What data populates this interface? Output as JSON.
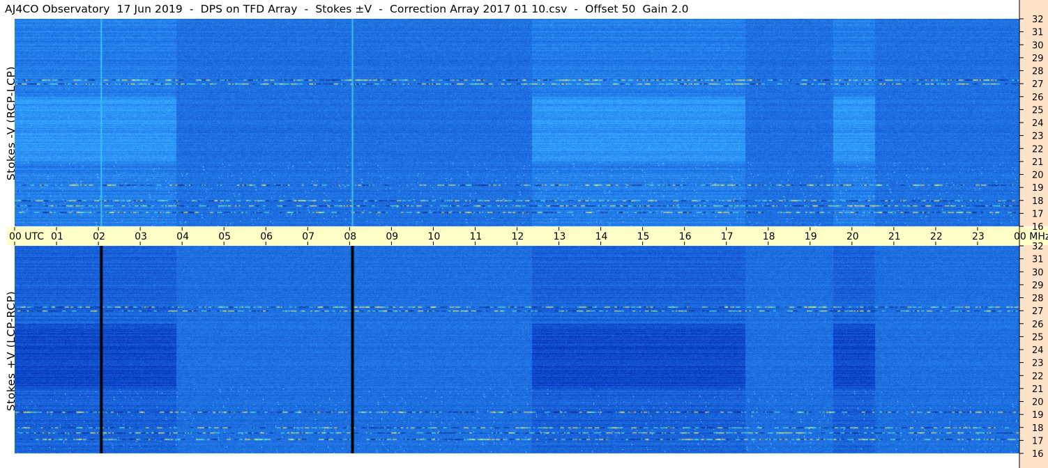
{
  "title": "AJ4CO Observatory  17 Jun 2019  -  DPS on TFD Array  -  Stokes ±V  -  Correction Array 2017 01 10.csv  -  Offset 50  Gain 2.0",
  "panels": [
    {
      "label": "Stokes -V (RCP-LCP)"
    },
    {
      "label": "Stokes +V (LCP-RCP)"
    }
  ],
  "colors": {
    "page_bg": "#ffffff",
    "time_axis_bg": "#ffffc8",
    "freq_axis_bg": "#ffe3c8",
    "spectrogram_base": "#1f6fe0",
    "dark_band": "#0a2a8a",
    "bright_band": "#38c8f0",
    "interference": "#ffff60",
    "dropout_line": "#000000"
  },
  "chart_data": {
    "type": "heatmap",
    "x_axis": {
      "unit": "UTC",
      "range": [
        0,
        24
      ],
      "tick_labels": [
        "00",
        "01",
        "02",
        "03",
        "04",
        "05",
        "06",
        "07",
        "08",
        "09",
        "10",
        "11",
        "12",
        "13",
        "14",
        "15",
        "16",
        "17",
        "18",
        "19",
        "20",
        "21",
        "22",
        "23",
        "00"
      ],
      "first_label_suffix": "UTC",
      "last_label_suffix": "MHz"
    },
    "y_axis": {
      "unit": "MHz",
      "range": [
        16,
        32
      ],
      "tick_labels": [
        "16",
        "17",
        "18",
        "19",
        "20",
        "21",
        "22",
        "23",
        "24",
        "25",
        "26",
        "27",
        "28",
        "29",
        "30",
        "31",
        "32"
      ]
    },
    "panels": [
      "Stokes -V (RCP-LCP)",
      "Stokes +V (LCP-RCP)"
    ],
    "features": {
      "time_markers_utc": [
        2.07,
        8.07
      ],
      "polarized_intervals_utc": [
        [
          0.0,
          3.85
        ],
        [
          12.35,
          17.45
        ],
        [
          19.55,
          20.55
        ]
      ],
      "interference_freqs_mhz": [
        17.1,
        17.6,
        18.0,
        19.2,
        27.0,
        27.3
      ],
      "polarized_band_mhz": [
        21.0,
        26.0
      ]
    }
  }
}
